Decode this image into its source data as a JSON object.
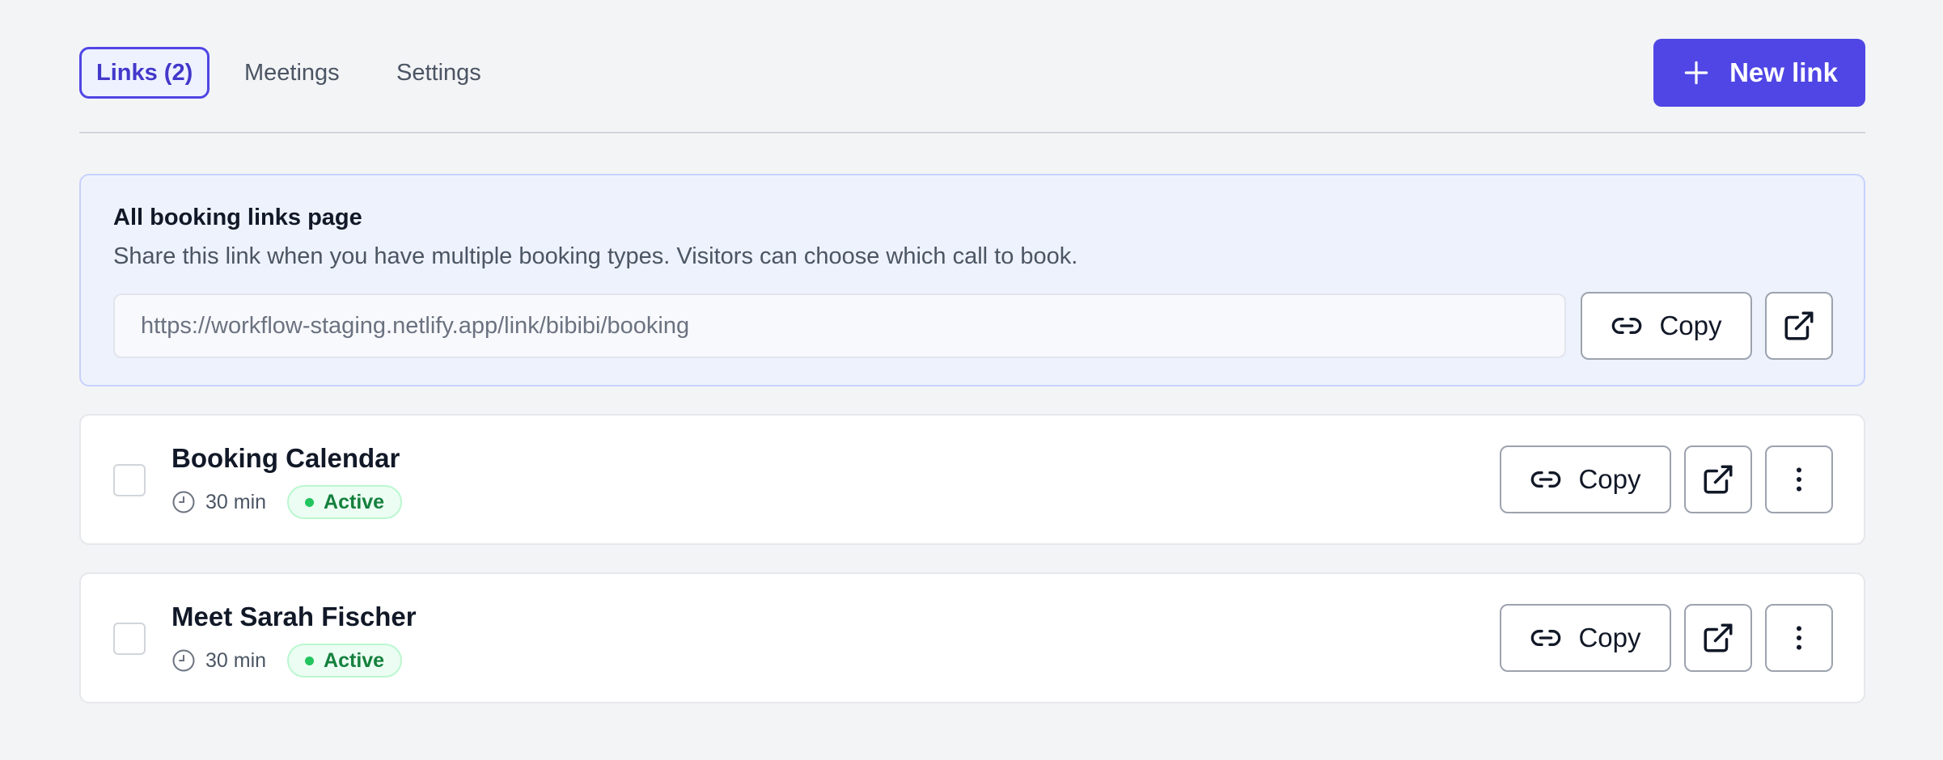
{
  "tabs": [
    {
      "label": "Links (2)",
      "active": true
    },
    {
      "label": "Meetings",
      "active": false
    },
    {
      "label": "Settings",
      "active": false
    }
  ],
  "new_link_button": {
    "label": "New link",
    "icon": "plus-icon"
  },
  "banner": {
    "title": "All booking links page",
    "description": "Share this link when you have multiple booking types. Visitors can choose which call to book.",
    "url": "https://workflow-staging.netlify.app/link/bibibi/booking",
    "copy_label": "Copy"
  },
  "links": [
    {
      "title": "Booking Calendar",
      "duration": "30 min",
      "status": "Active",
      "copy_label": "Copy"
    },
    {
      "title": "Meet Sarah Fischer",
      "duration": "30 min",
      "status": "Active",
      "copy_label": "Copy"
    }
  ],
  "colors": {
    "accent": "#4f46e5",
    "active_status": "#15803d",
    "background": "#f3f4f6"
  }
}
